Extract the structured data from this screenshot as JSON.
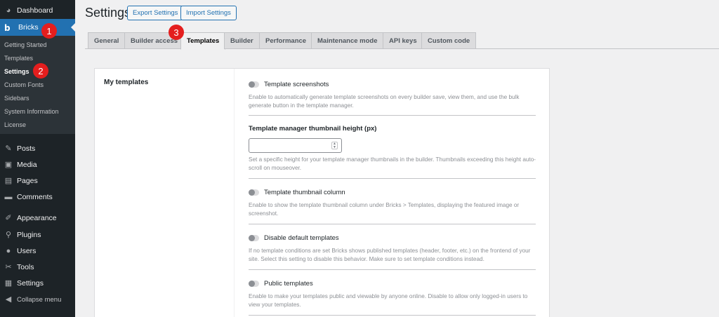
{
  "sidebar": {
    "items": [
      {
        "label": "Dashboard",
        "icon": "dashboard-icon",
        "glyph": "◕"
      },
      {
        "label": "Bricks",
        "icon": "bricks-logo-icon",
        "glyph": "b"
      },
      {
        "label": "Posts",
        "icon": "pin-icon",
        "glyph": "✎"
      },
      {
        "label": "Media",
        "icon": "media-icon",
        "glyph": "▣"
      },
      {
        "label": "Pages",
        "icon": "pages-icon",
        "glyph": "▤"
      },
      {
        "label": "Comments",
        "icon": "comments-icon",
        "glyph": "▬"
      },
      {
        "label": "Appearance",
        "icon": "paintbrush-icon",
        "glyph": "✐"
      },
      {
        "label": "Plugins",
        "icon": "plugin-icon",
        "glyph": "⚲"
      },
      {
        "label": "Users",
        "icon": "users-icon",
        "glyph": "●"
      },
      {
        "label": "Tools",
        "icon": "wrench-icon",
        "glyph": "✂"
      },
      {
        "label": "Settings",
        "icon": "settings-icon",
        "glyph": "▦"
      },
      {
        "label": "Collapse menu",
        "icon": "collapse-icon",
        "glyph": "◀"
      }
    ],
    "submenu": [
      "Getting Started",
      "Templates",
      "Settings",
      "Custom Fonts",
      "Sidebars",
      "System Information",
      "License"
    ]
  },
  "badges": [
    "1",
    "2",
    "3"
  ],
  "header": {
    "title": "Settings",
    "export_label": "Export Settings",
    "import_label": "Import Settings"
  },
  "tabs": [
    "General",
    "Builder access",
    "Templates",
    "Builder",
    "Performance",
    "Maintenance mode",
    "API keys",
    "Custom code"
  ],
  "active_tab": "Templates",
  "section": {
    "label": "My templates",
    "options": [
      {
        "title": "Template screenshots",
        "desc": "Enable to automatically generate template screenshots on every builder save, view them, and use the bulk generate button in the template manager."
      },
      {
        "title": "Template manager thumbnail height (px)",
        "desc": "Set a specific height for your template manager thumbnails in the builder. Thumbnails exceeding this height auto-scroll on mouseover.",
        "input_value": ""
      },
      {
        "title": "Template thumbnail column",
        "desc": "Enable to show the template thumbnail column under Bricks > Templates, displaying the featured image or screenshot."
      },
      {
        "title": "Disable default templates",
        "desc": "If no template conditions are set Bricks shows published templates (header, footer, etc.) on the frontend of your site. Select this setting to disable this behavior. Make sure to set template conditions instead."
      },
      {
        "title": "Public templates",
        "desc": "Enable to make your templates public and viewable by anyone online. Disable to allow only logged-in users to view your templates."
      }
    ]
  },
  "colors": {
    "accent": "#2271b1",
    "badge": "#e41e1e",
    "sidebar": "#1d2327"
  }
}
